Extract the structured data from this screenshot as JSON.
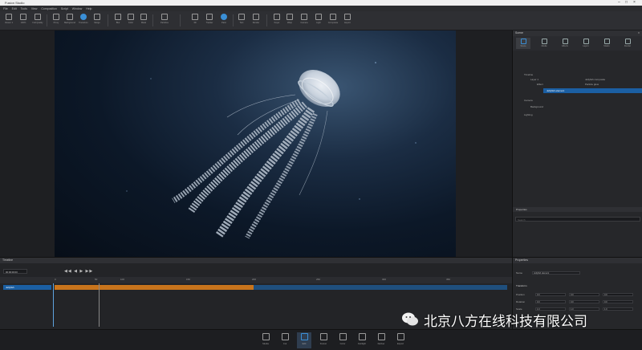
{
  "window": {
    "title": "Fusion Studio"
  },
  "menu": [
    "File",
    "Edit",
    "Tools",
    "View",
    "Composition",
    "Script",
    "Window",
    "Help"
  ],
  "toolbar": {
    "items": [
      {
        "label": "Viewer 1"
      },
      {
        "label": "100%"
      },
      {
        "label": "Full Quality"
      },
      {
        "label": "Proxy"
      },
      {
        "label": "Background"
      },
      {
        "label": "Transform"
      },
      {
        "label": "Merge"
      },
      {
        "label": "Blur"
      },
      {
        "label": "Color"
      },
      {
        "label": "Mask"
      },
      {
        "label": "Particles"
      },
      {
        "label": "3D"
      },
      {
        "label": "Tracker"
      },
      {
        "label": "Paint"
      },
      {
        "label": "Text"
      },
      {
        "label": "Render"
      },
      {
        "label": "Keyer"
      },
      {
        "label": "Warp"
      },
      {
        "label": "Camera"
      },
      {
        "label": "Light"
      },
      {
        "label": "Composite"
      },
      {
        "label": "Export"
      }
    ]
  },
  "scene_panel": {
    "title": "Scene",
    "tabs": [
      {
        "label": "Scene"
      },
      {
        "label": "Media"
      },
      {
        "label": "Effects"
      },
      {
        "label": "Layers"
      },
      {
        "label": "Masks"
      },
      {
        "label": "Render"
      }
    ],
    "tree": [
      {
        "label": "Timeline",
        "note": ""
      },
      {
        "label": "Layer 1",
        "note": "Jellyfish composite"
      },
      {
        "label": "Effect",
        "note": "Particle glow"
      },
      {
        "label": "Jellyfish element",
        "note": ""
      },
      {
        "label": "Camera",
        "note": ""
      },
      {
        "label": "Background",
        "note": ""
      },
      {
        "label": "Lighting",
        "note": ""
      }
    ],
    "footer": {
      "label": "Properties",
      "input_placeholder": "Search"
    }
  },
  "timeline": {
    "title": "Timeline",
    "layer_label": "Jellyfish",
    "ruler": [
      "0",
      "50",
      "100",
      "150",
      "200",
      "250",
      "300",
      "350",
      "400",
      "450",
      "500"
    ],
    "transport_label": "00:00:00:00"
  },
  "properties": {
    "title": "Properties",
    "name_label": "Name",
    "name_value": "Jellyfish element",
    "section": "Transform",
    "rows": [
      {
        "label": "Position",
        "x": "0.0",
        "y": "0.0",
        "z": "0.0"
      },
      {
        "label": "Rotation",
        "x": "0.0",
        "y": "0.0",
        "z": "0.0"
      },
      {
        "label": "Scale",
        "x": "1.0",
        "y": "1.0",
        "z": "1.0"
      }
    ]
  },
  "bottom_bar": [
    {
      "label": "Media"
    },
    {
      "label": "Cut"
    },
    {
      "label": "Edit"
    },
    {
      "label": "Fusion"
    },
    {
      "label": "Color"
    },
    {
      "label": "Fairlight"
    },
    {
      "label": "Deliver"
    },
    {
      "label": "Export"
    }
  ],
  "watermark": "北京八方在线科技有限公司"
}
